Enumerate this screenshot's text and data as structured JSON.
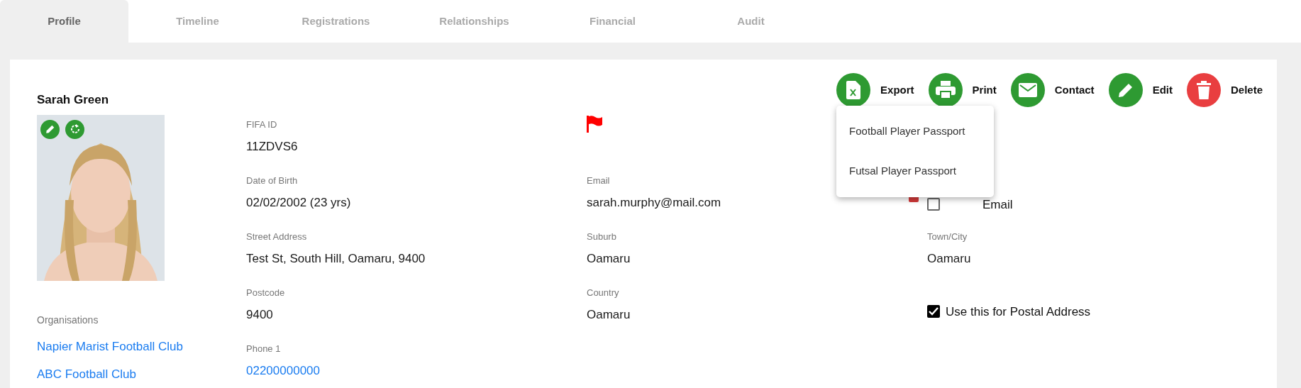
{
  "tabs": [
    {
      "label": "Profile",
      "selected": true
    },
    {
      "label": "Timeline",
      "selected": false
    },
    {
      "label": "Registrations",
      "selected": false
    },
    {
      "label": "Relationships",
      "selected": false
    },
    {
      "label": "Financial",
      "selected": false
    },
    {
      "label": "Audit",
      "selected": false
    }
  ],
  "profile": {
    "name": "Sarah Green",
    "photo": {
      "kind": "picture"
    },
    "organisations_label": "Organisations",
    "organisations": [
      "Napier Marist Football Club",
      "ABC Football Club"
    ]
  },
  "actions": [
    {
      "label": "Export",
      "kind": "export",
      "color": "#2e9a32",
      "expanded": true
    },
    {
      "label": "Print",
      "kind": "print",
      "color": "#2e9a32",
      "expanded": false
    },
    {
      "label": "Contact",
      "kind": "contact",
      "color": "#2e9a32",
      "expanded": false
    },
    {
      "label": "Edit",
      "kind": "edit",
      "color": "#2e9a32",
      "expanded": false
    },
    {
      "label": "Delete",
      "kind": "delete",
      "color": "#e93e40",
      "expanded": false
    }
  ],
  "export_menu": [
    "Football Player Passport",
    "Futsal Player Passport"
  ],
  "rows": [
    [
      {
        "kind": "field",
        "label": "FIFA ID",
        "value": "11ZDVS6"
      },
      {
        "kind": "flag"
      },
      null
    ],
    [
      {
        "kind": "field",
        "label": "Date of Birth",
        "value": "02/02/2002 (23 yrs)"
      },
      {
        "kind": "field",
        "label": "Email",
        "value": "sarah.murphy@mail.com",
        "alert": true
      },
      {
        "kind": "checkbox",
        "label": "Email",
        "checked": false,
        "partly_covered": true
      }
    ],
    [
      {
        "kind": "field",
        "label": "Street Address",
        "value": "Test St, South Hill, Oamaru, 9400"
      },
      {
        "kind": "field",
        "label": "Suburb",
        "value": "Oamaru"
      },
      {
        "kind": "field",
        "label": "Town/City",
        "value": "Oamaru"
      }
    ],
    [
      {
        "kind": "field",
        "label": "Postcode",
        "value": "9400"
      },
      {
        "kind": "field",
        "label": "Country",
        "value": "Oamaru"
      },
      {
        "kind": "checkbox",
        "label": "Use this for Postal Address",
        "checked": true
      }
    ],
    [
      {
        "kind": "link",
        "label": "Phone 1",
        "value": "02200000000"
      },
      null,
      null
    ]
  ]
}
